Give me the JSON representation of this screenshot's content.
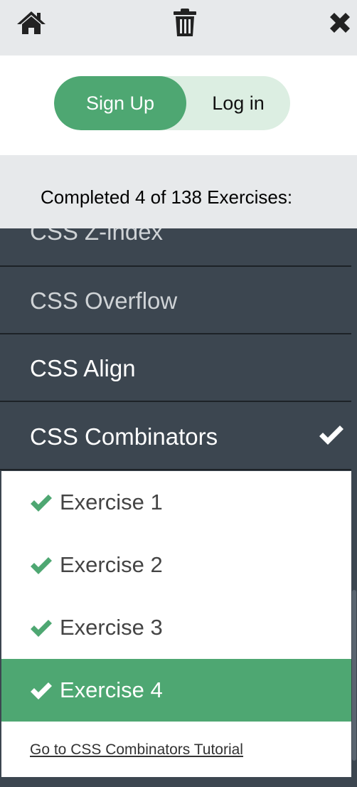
{
  "toolbar": {
    "home_icon": "home-icon",
    "trash_icon": "trash-icon",
    "close_icon": "close-icon"
  },
  "auth": {
    "signup_label": "Sign Up",
    "login_label": "Log in"
  },
  "progress": {
    "text": "Completed 4 of 138 Exercises:",
    "completed": 4,
    "total": 138
  },
  "topics": [
    {
      "label": "CSS Z-index"
    },
    {
      "label": "CSS Overflow"
    },
    {
      "label": "CSS Align"
    },
    {
      "label": "CSS Combinators",
      "completed": true
    }
  ],
  "exercises": [
    {
      "label": "Exercise 1",
      "completed": true
    },
    {
      "label": "Exercise 2",
      "completed": true
    },
    {
      "label": "Exercise 3",
      "completed": true
    },
    {
      "label": "Exercise 4",
      "completed": true,
      "active": true
    }
  ],
  "tutorial_link": "Go to CSS Combinators Tutorial",
  "colors": {
    "accent": "#4ea772",
    "accent_light": "#dceee2",
    "menu_bg": "#3c4650",
    "topbar_bg": "#e7e9eb"
  }
}
